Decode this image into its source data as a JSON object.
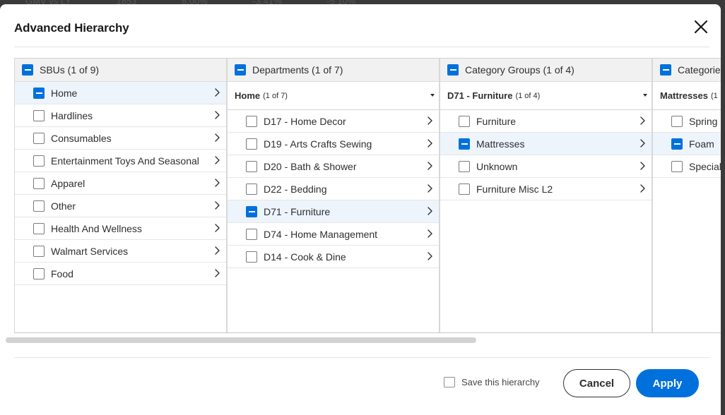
{
  "backdrop": {
    "items": [
      "GMV vs LY",
      "1853",
      "8.00%",
      "-3.41%",
      "-5.10%"
    ]
  },
  "dialog": {
    "title": "Advanced Hierarchy",
    "save_label": "Save this hierarchy",
    "cancel_label": "Cancel",
    "apply_label": "Apply"
  },
  "columns": [
    {
      "header": "SBUs (1 of 9)",
      "items": [
        "Home",
        "Hardlines",
        "Consumables",
        "Entertainment Toys And Seasonal",
        "Apparel",
        "Other",
        "Health And Wellness",
        "Walmart Services",
        "Food"
      ],
      "selected_index": 0
    },
    {
      "header": "Departments (1 of 7)",
      "sub_label": "Home",
      "sub_count": "(1 of 7)",
      "items": [
        "D17 - Home Decor",
        "D19 - Arts Crafts Sewing",
        "D20 - Bath & Shower",
        "D22 - Bedding",
        "D71 - Furniture",
        "D74 - Home Management",
        "D14 - Cook & Dine"
      ],
      "selected_index": 4
    },
    {
      "header": "Category Groups (1 of 4)",
      "sub_label": "D71 - Furniture",
      "sub_count": "(1 of 4)",
      "items": [
        "Furniture",
        "Mattresses",
        "Unknown",
        "Furniture Misc L2"
      ],
      "selected_index": 1
    },
    {
      "header": "Categories",
      "sub_label": "Mattresses",
      "sub_count": "(1",
      "items": [
        "Spring",
        "Foam",
        "Speciali"
      ],
      "selected_index": 1
    }
  ],
  "colors": {
    "accent": "#0071dc",
    "selected_row": "#eef4fc",
    "header_bg": "#f1f1f2"
  },
  "icons": {
    "close": "close-icon",
    "chevron": "chevron-right-icon",
    "caret": "caret-down-icon"
  }
}
